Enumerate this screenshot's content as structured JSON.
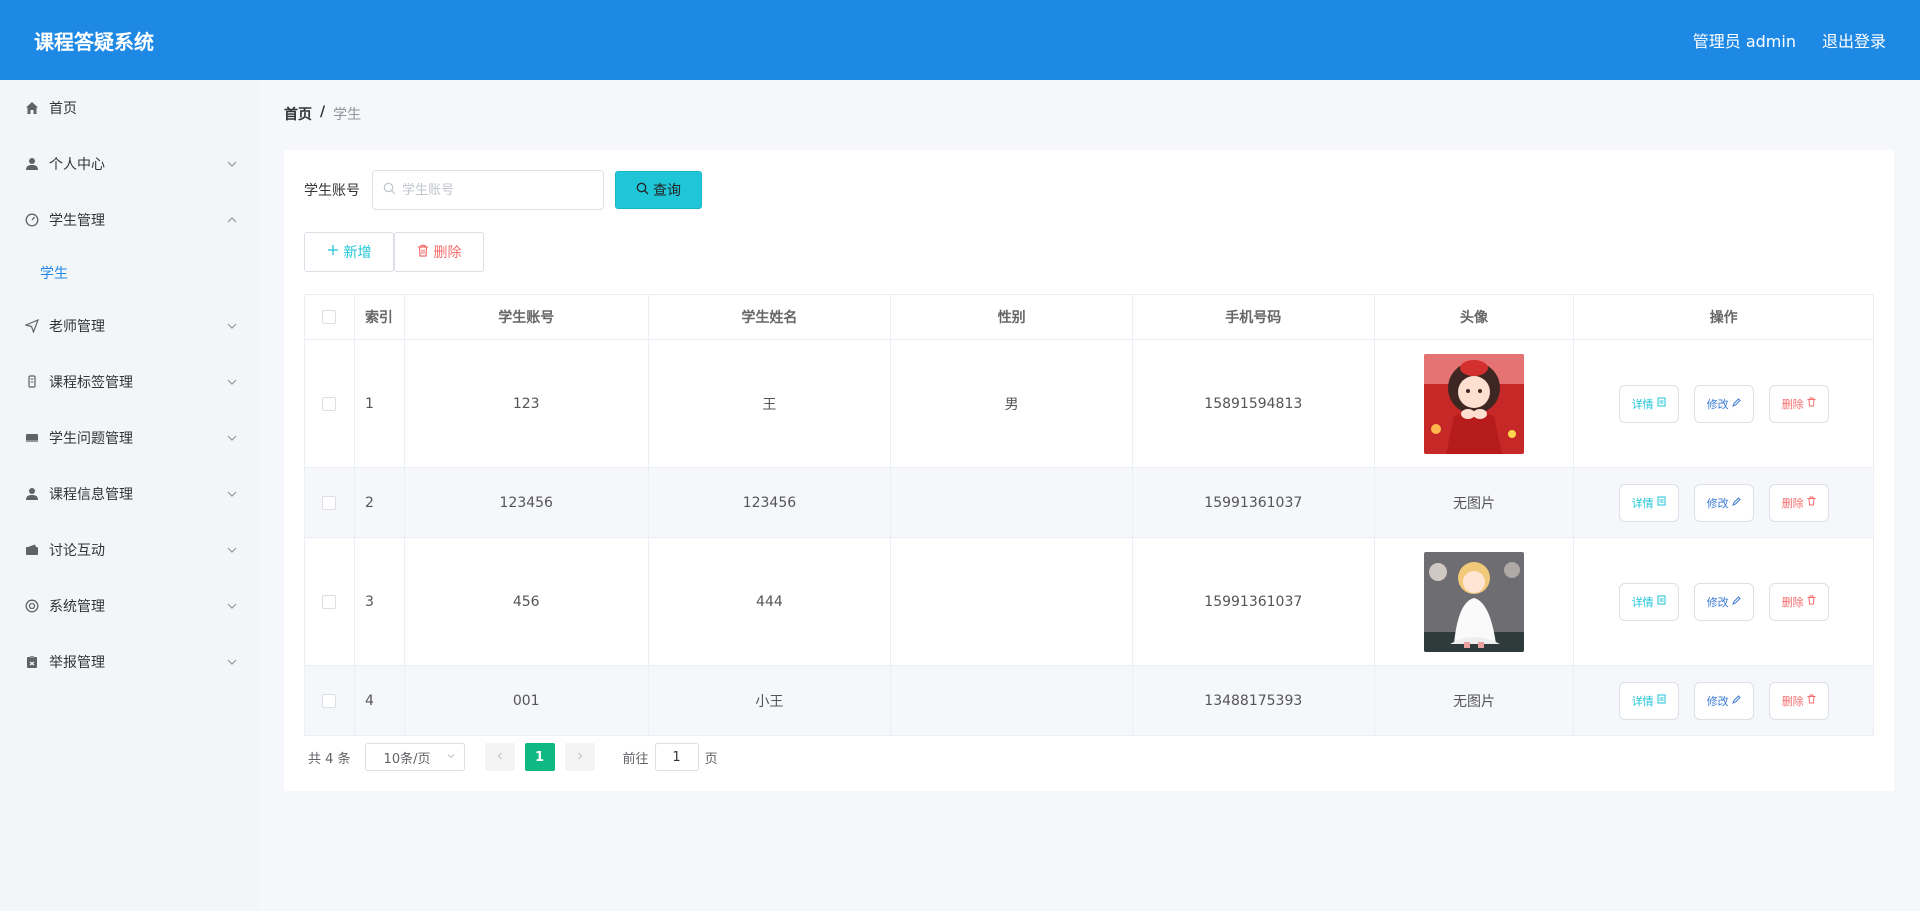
{
  "header": {
    "title": "课程答疑系统",
    "user": "管理员 admin",
    "logout": "退出登录"
  },
  "sidebar": {
    "items": [
      {
        "label": "首页",
        "icon": "home-icon"
      },
      {
        "label": "个人中心",
        "icon": "user-icon"
      },
      {
        "label": "学生管理",
        "icon": "dashboard-icon",
        "expanded": true
      },
      {
        "label": "老师管理",
        "icon": "send-icon"
      },
      {
        "label": "课程标签管理",
        "icon": "tag-icon"
      },
      {
        "label": "学生问题管理",
        "icon": "ticket-icon"
      },
      {
        "label": "课程信息管理",
        "icon": "user-icon"
      },
      {
        "label": "讨论互动",
        "icon": "wallet-icon"
      },
      {
        "label": "系统管理",
        "icon": "settings-icon"
      },
      {
        "label": "举报管理",
        "icon": "clipboard-icon"
      }
    ],
    "sub_active": "学生"
  },
  "breadcrumb": {
    "home": "首页",
    "separator": "/",
    "current": "学生"
  },
  "search": {
    "label": "学生账号",
    "placeholder": "学生账号",
    "value": "",
    "button": "查询"
  },
  "actions": {
    "add": "新增",
    "delete": "删除"
  },
  "table": {
    "headers": [
      "索引",
      "学生账号",
      "学生姓名",
      "性别",
      "手机号码",
      "头像",
      "操作"
    ],
    "rows": [
      {
        "index": "1",
        "account": "123",
        "name": "王",
        "gender": "男",
        "phone": "15891594813",
        "avatar": "image",
        "avatar_text": ""
      },
      {
        "index": "2",
        "account": "123456",
        "name": "123456",
        "gender": "",
        "phone": "15991361037",
        "avatar": "none",
        "avatar_text": "无图片"
      },
      {
        "index": "3",
        "account": "456",
        "name": "444",
        "gender": "",
        "phone": "15991361037",
        "avatar": "image",
        "avatar_text": ""
      },
      {
        "index": "4",
        "account": "001",
        "name": "小王",
        "gender": "",
        "phone": "13488175393",
        "avatar": "none",
        "avatar_text": "无图片"
      }
    ],
    "ops": {
      "detail": "详情",
      "edit": "修改",
      "remove": "删除"
    }
  },
  "pagination": {
    "total": "共 4 条",
    "page_size": "10条/页",
    "current_page": "1",
    "goto_prefix": "前往",
    "goto_value": "1",
    "goto_suffix": "页"
  },
  "colors": {
    "header_bg": "#1e88e5",
    "accent": "#1fc6d8",
    "danger": "#f56c6c",
    "active_page": "#10b981"
  }
}
